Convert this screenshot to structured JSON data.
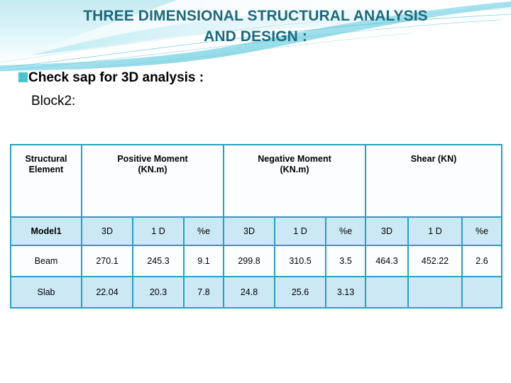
{
  "slide": {
    "title_lines": [
      "THREE DIMENSIONAL STRUCTURAL ANALYSIS",
      "AND DESIGN :"
    ],
    "title_color": "#1b6a7d",
    "bullet_glyph": "■",
    "bullet_text": "Check sap for 3D analysis :",
    "sub_text": "Block2:",
    "accent_color": "#2a9fc2",
    "banner_color_light": "#bff0f4",
    "banner_color_mid": "#6fd3e0",
    "banner_color_dark": "#2aa8c4",
    "row_fill_alt": "#cbe8f4",
    "row_fill": "#fbfdfe"
  },
  "table": {
    "group_headers": [
      {
        "label": "Structural\nElement",
        "line1": "Structural",
        "line2": "Element"
      },
      {
        "label": "Positive Moment (KN.m)",
        "line1": "Positive Moment",
        "line2": "(KN.m)"
      },
      {
        "label": "Negative  Moment (KN.m)",
        "line1": "Negative  Moment",
        "line2": "(KN.m)"
      },
      {
        "label": "Shear (KN)",
        "line1": "Shear (KN)",
        "line2": ""
      }
    ],
    "sub_headers": [
      "Model1",
      "3D",
      "1 D",
      "%e",
      "3D",
      "1 D",
      "%e",
      "3D",
      "1 D",
      "%e"
    ],
    "rows": [
      {
        "name": "Beam",
        "cells": [
          "270.1",
          "245.3",
          "9.1",
          "299.8",
          "310.5",
          "3.5",
          "464.3",
          "452.22",
          "2.6"
        ]
      },
      {
        "name": "Slab",
        "cells": [
          "22.04",
          "20.3",
          "7.8",
          "24.8",
          "25.6",
          "3.13",
          "",
          "",
          ""
        ]
      }
    ]
  }
}
